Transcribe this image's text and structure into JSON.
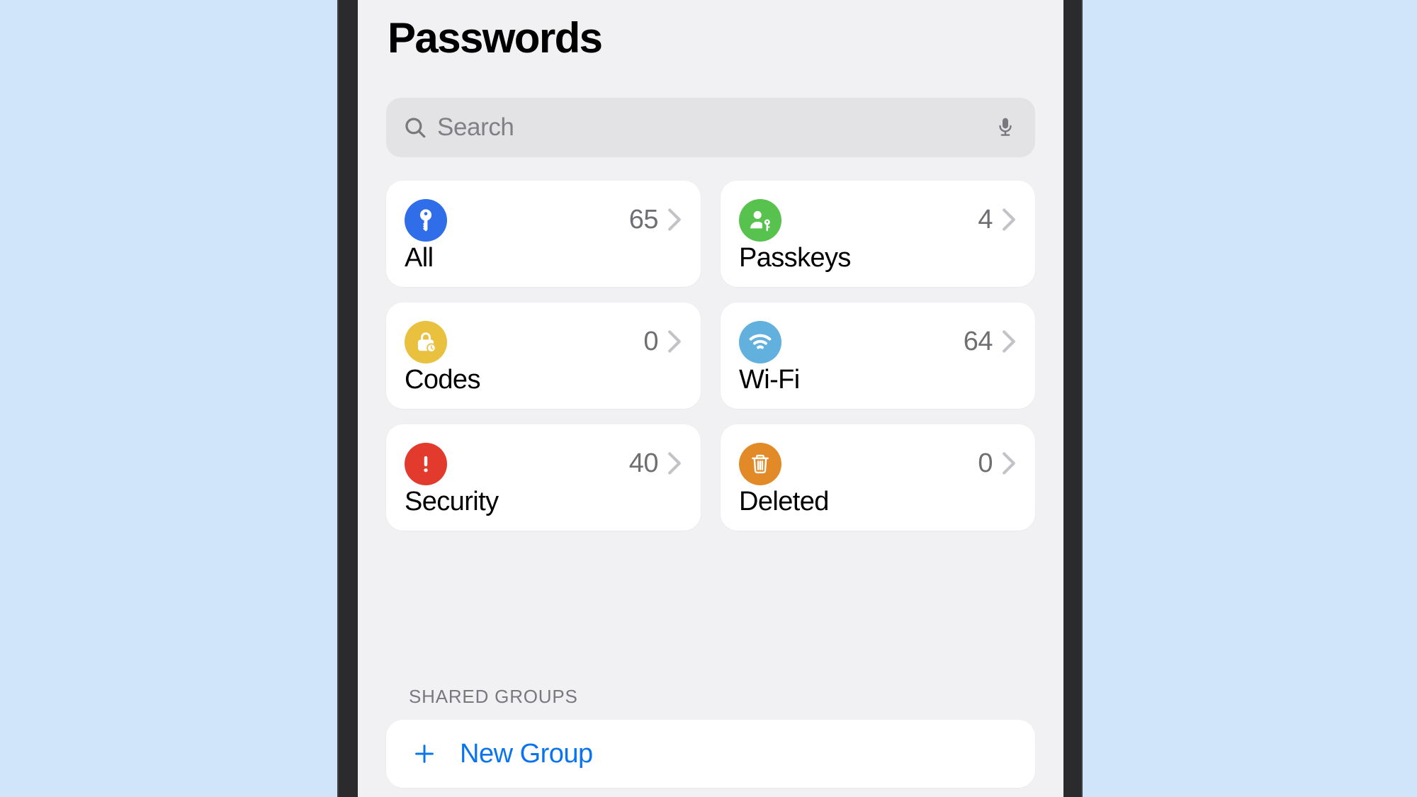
{
  "app": {
    "title": "Passwords",
    "accent_color": "#0a74f0",
    "screen_background": "#f1f1f4",
    "page_background": "#d0e4fa"
  },
  "search": {
    "placeholder": "Search",
    "value": "",
    "search_icon": "search-icon",
    "mic_icon": "microphone-icon"
  },
  "categories": [
    {
      "label": "All",
      "count": "65",
      "icon": "key-icon",
      "color": "#2f6ee8",
      "chevron": "chevron-right-icon"
    },
    {
      "label": "Passkeys",
      "count": "4",
      "icon": "person-key-icon",
      "color": "#58c24f",
      "chevron": "chevron-right-icon"
    },
    {
      "label": "Codes",
      "count": "0",
      "icon": "lock-clock-icon",
      "color": "#e9c13e",
      "chevron": "chevron-right-icon"
    },
    {
      "label": "Wi-Fi",
      "count": "64",
      "icon": "wifi-icon",
      "color": "#61b0dd",
      "chevron": "chevron-right-icon"
    },
    {
      "label": "Security",
      "count": "40",
      "icon": "exclamation-icon",
      "color": "#e23b2e",
      "chevron": "chevron-right-icon"
    },
    {
      "label": "Deleted",
      "count": "0",
      "icon": "trash-icon",
      "color": "#e28a28",
      "chevron": "chevron-right-icon"
    }
  ],
  "shared_groups": {
    "header": "SHARED GROUPS",
    "new_group_label": "New Group",
    "plus_icon": "plus-icon"
  }
}
